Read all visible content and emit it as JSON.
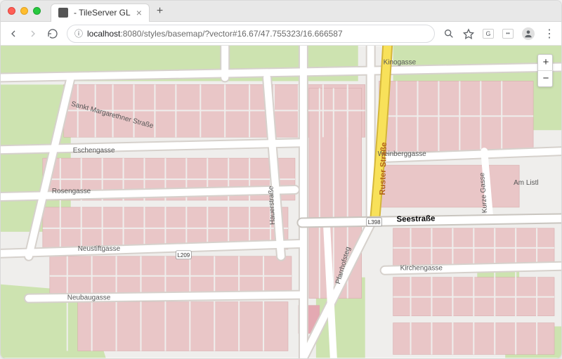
{
  "browser": {
    "tab_title": "- TileServer GL",
    "url_host": "localhost",
    "url_port": ":8080",
    "url_path": "/styles/basemap/?vector#16.67/47.755323/16.666587"
  },
  "map": {
    "streets": {
      "kinogasse": "Kinogasse",
      "sankt_margarethner": "Sankt Margarethner Straße",
      "eschengasse": "Eschengasse",
      "rosengasse": "Rosengasse",
      "weinberggasse": "Weinberggasse",
      "hauerstrasse": "Hauerstraße",
      "ruster_strasse": "Ruster Straße",
      "am_listl": "Am Listl",
      "kurze_gasse": "Kurze Gasse",
      "seestrasse": "Seestraße",
      "neustiftgasse": "Neustiftgasse",
      "pfarrhofsteg": "Pfarrhofsteg",
      "kirchengasse": "Kirchengasse",
      "neubaugasse": "Neubaugasse",
      "route_badge_l308": "L398",
      "route_badge_l209": "L209"
    }
  },
  "controls": {
    "zoom_in": "+",
    "zoom_out": "−"
  },
  "colors": {
    "green": "#cde3b0",
    "road": "#ffffff",
    "road_casing": "#d6d1cc",
    "building": "#e9c6c7",
    "building_edge": "#d8adae",
    "bg": "#efeeec",
    "highlight_road": "#f8e15a",
    "highlight_casing": "#d4b63a"
  }
}
